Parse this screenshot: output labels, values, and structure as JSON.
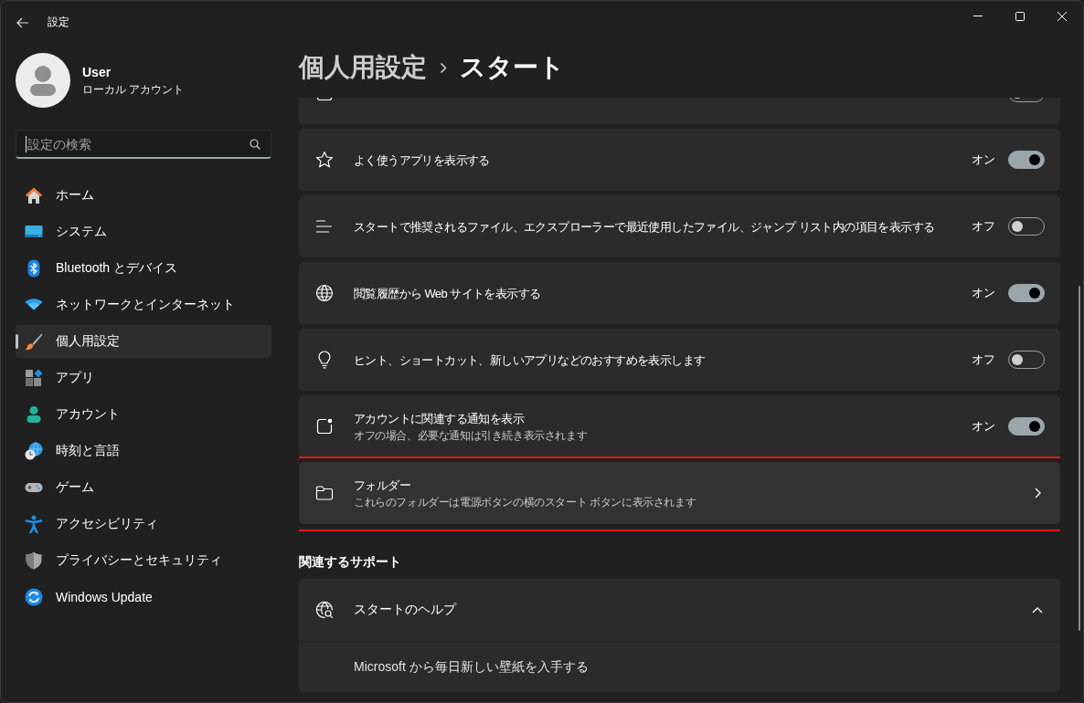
{
  "window": {
    "title": "設定"
  },
  "account": {
    "name": "User",
    "type": "ローカル アカウント"
  },
  "search": {
    "placeholder": "設定の検索",
    "focused": true
  },
  "sidebar": {
    "items": [
      {
        "label": "ホーム",
        "selected": false
      },
      {
        "label": "システム",
        "selected": false
      },
      {
        "label": "Bluetooth とデバイス",
        "selected": false
      },
      {
        "label": "ネットワークとインターネット",
        "selected": false
      },
      {
        "label": "個人用設定",
        "selected": true
      },
      {
        "label": "アプリ",
        "selected": false
      },
      {
        "label": "アカウント",
        "selected": false
      },
      {
        "label": "時刻と言語",
        "selected": false
      },
      {
        "label": "ゲーム",
        "selected": false
      },
      {
        "label": "アクセシビリティ",
        "selected": false
      },
      {
        "label": "プライバシーとセキュリティ",
        "selected": false
      },
      {
        "label": "Windows Update",
        "selected": false
      }
    ]
  },
  "header": {
    "parent": "個人用設定",
    "current": "スタート"
  },
  "settings": [
    {
      "kind": "toggle",
      "on": false,
      "highlighted": false
    },
    {
      "kind": "toggle",
      "label": "よく使うアプリを表示する",
      "state_text": "オン",
      "on": true,
      "highlighted": false
    },
    {
      "kind": "toggle",
      "label": "スタートで推奨されるファイル、エクスプローラーで最近使用したファイル、ジャンプ リスト内の項目を表示する",
      "state_text": "オフ",
      "on": false,
      "highlighted": false
    },
    {
      "kind": "toggle",
      "label": "閲覧履歴から Web サイトを表示する",
      "state_text": "オン",
      "on": true,
      "highlighted": false
    },
    {
      "kind": "toggle",
      "label": "ヒント、ショートカット、新しいアプリなどのおすすめを表示します",
      "state_text": "オフ",
      "on": false,
      "highlighted": false
    },
    {
      "kind": "toggle",
      "label": "アカウントに関連する通知を表示",
      "description": "オフの場合、必要な通知は引き続き表示されます",
      "state_text": "オン",
      "on": true,
      "highlighted": false
    },
    {
      "kind": "link",
      "label": "フォルダー",
      "description": "これらのフォルダーは電源ボタンの横のスタート ボタンに表示されます",
      "highlighted": true
    }
  ],
  "related_support": {
    "heading": "関連するサポート",
    "items": [
      {
        "title": "スタートのヘルプ",
        "expanded": true,
        "links": [
          "Microsoft から毎日新しい壁紙を入手する"
        ]
      }
    ]
  }
}
